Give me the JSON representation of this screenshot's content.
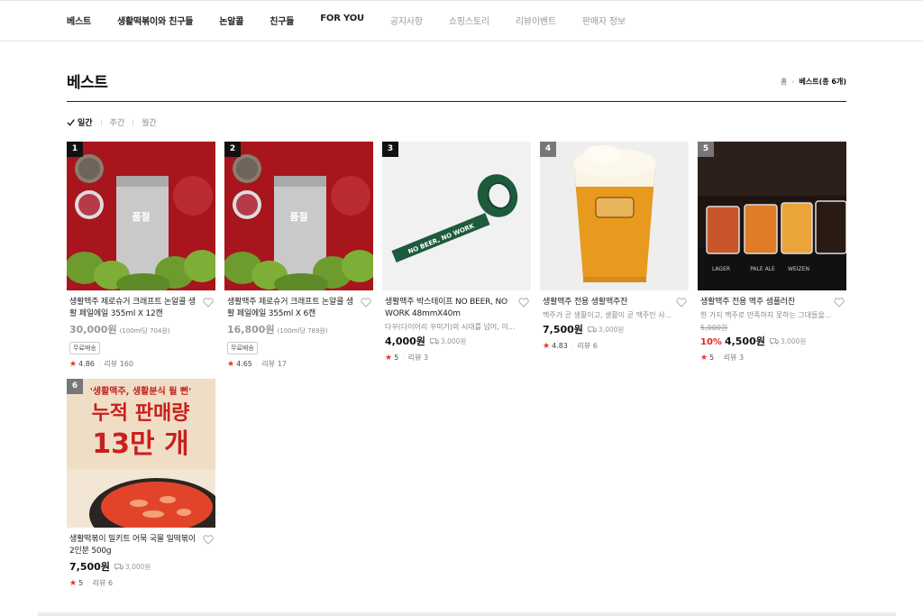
{
  "nav": {
    "items": [
      {
        "label": "베스트",
        "active": true
      },
      {
        "label": "생활떡볶이와 친구들",
        "active": true
      },
      {
        "label": "논알콜",
        "active": true
      },
      {
        "label": "친구들",
        "active": true
      },
      {
        "label": "FOR YOU",
        "active": true
      },
      {
        "label": "공지사항",
        "active": false
      },
      {
        "label": "쇼핑스토리",
        "active": false
      },
      {
        "label": "리뷰이벤트",
        "active": false
      },
      {
        "label": "판매자 정보",
        "active": false
      }
    ]
  },
  "page": {
    "title": "베스트",
    "breadcrumb_home": "홈",
    "breadcrumb_current": "베스트(총 6개)"
  },
  "period_filter": {
    "options": [
      "일간",
      "주간",
      "월간"
    ],
    "selected": "일간"
  },
  "products": [
    {
      "rank": "1",
      "name": "생활맥주 제로슈거 크래프트 논알콜 생활 페일에일 355ml X 12캔",
      "soldout_label": "품절",
      "price": "30,000원",
      "unit_price": "(100ml당 704원)",
      "badge": "무료배송",
      "score": "4.86",
      "reviews": "리뷰 160"
    },
    {
      "rank": "2",
      "name": "생활맥주 제로슈거 크래프트 논알콜 생활 페일에일 355ml X 6캔",
      "soldout_label": "품절",
      "price": "16,800원",
      "unit_price": "(100ml당 789원)",
      "badge": "무료배송",
      "score": "4.65",
      "reviews": "리뷰 17"
    },
    {
      "rank": "3",
      "name": "생활맥주 박스테이프 NO BEER, NO WORK 48mmX40m",
      "desc": "다꾸(다이어리 꾸미기)의 시대를 넘어, 이...",
      "price": "4,000원",
      "shipping": "3,000원",
      "score": "5",
      "reviews": "리뷰 3",
      "tape_text": "NO BEER, NO WORK"
    },
    {
      "rank": "4",
      "name": "생활맥주 전용 생활맥주잔",
      "desc": "맥주가 곧 생활이고, 생활이 곧 맥주인 사...",
      "price": "7,500원",
      "shipping": "3,000원",
      "score": "4.83",
      "reviews": "리뷰 6"
    },
    {
      "rank": "5",
      "name": "생활맥주 전용 맥주 샘플러잔",
      "desc": "한 가지 맥주로 만족하지 못하는 그대들을...",
      "original_price": "5,000원",
      "discount": "10%",
      "price": "4,500원",
      "shipping": "3,000원",
      "score": "5",
      "reviews": "리뷰 3",
      "mat_labels": [
        "LAGER",
        "PALE ALE",
        "WEIZEN"
      ]
    },
    {
      "rank": "6",
      "name": "생활떡볶이 밀키트 어묵 국물 밀떡볶이 2인분 500g",
      "price": "7,500원",
      "shipping": "3,000원",
      "score": "5",
      "reviews": "리뷰 6",
      "poster_line1": "'생활맥주, 생활분식 될 뻔'",
      "poster_line2": "누적 판매량",
      "poster_line3": "13만 개"
    }
  ],
  "colors": {
    "accent_red": "#e02424",
    "product_bg_red": "#a8151c",
    "rank_badge": "#111111"
  }
}
